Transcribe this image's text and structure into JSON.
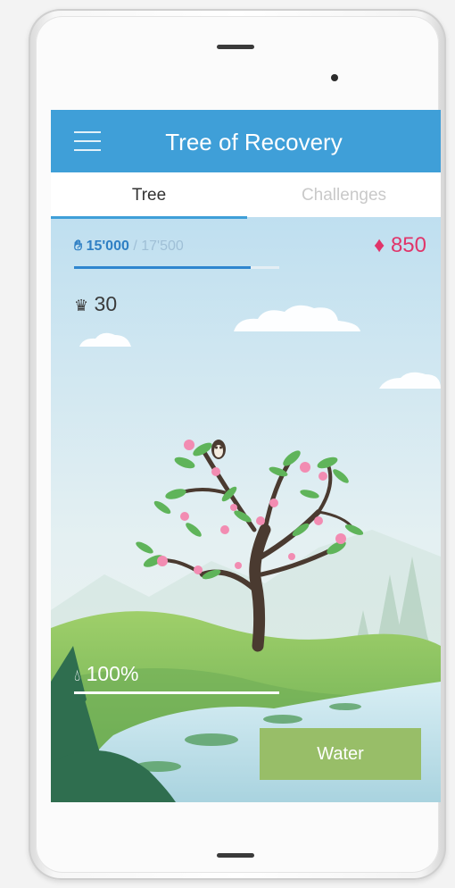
{
  "app": {
    "title": "Tree of Recovery"
  },
  "tabs": [
    {
      "label": "Tree",
      "active": true
    },
    {
      "label": "Challenges",
      "active": false
    }
  ],
  "stats": {
    "xp_current": "15'000",
    "xp_separator": "/",
    "xp_max": "17'500",
    "xp_progress": 0.86,
    "gems": "850",
    "crowns": "30",
    "water_percent": "100%",
    "water_level": 1.0
  },
  "actions": {
    "water_label": "Water"
  },
  "icons": {
    "menu": "menu-icon",
    "xp": "hand-icon",
    "gem": "diamond-icon",
    "crown": "crown-icon",
    "water": "water-drop-icon"
  },
  "colors": {
    "accent": "#3f9fd8",
    "gem": "#e0356a",
    "button": "#98be68"
  }
}
